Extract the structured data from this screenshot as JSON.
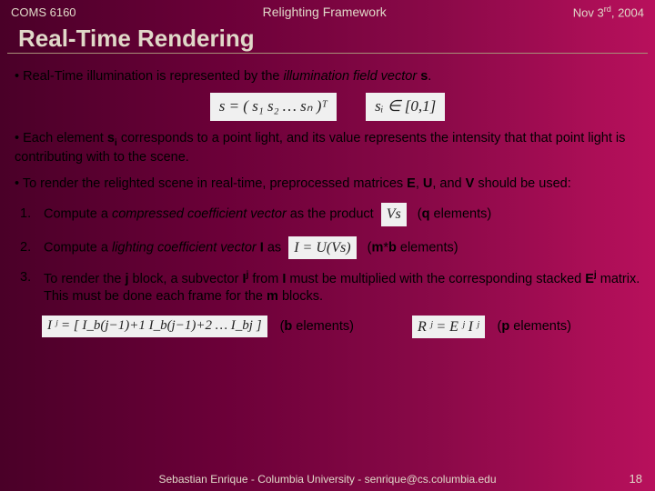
{
  "header": {
    "left": "COMS 6160",
    "center": "Relighting Framework",
    "right_pre": "Nov 3",
    "right_sup": "rd",
    "right_post": ", 2004"
  },
  "title": "Real-Time Rendering",
  "bullet1_a": "• Real-Time illumination is represented by the ",
  "bullet1_b": "illumination field vector ",
  "bullet1_c": "s",
  "bullet1_d": ".",
  "formula1_left": "s = ( s₁  s₂  …  sₙ )ᵀ",
  "formula1_right": "sᵢ ∈ [0,1]",
  "bullet2_a": "• Each element ",
  "bullet2_b": "s",
  "bullet2_c": " corresponds to a point light, and its value represents the intensity that that point light is contributing with to the scene.",
  "bullet2_sub": "i",
  "bullet3_a": "• To render the relighted scene in real-time, preprocessed matrices ",
  "bullet3_E": "E",
  "bullet3_U": "U",
  "bullet3_V": "V",
  "bullet3_b": ", and ",
  "bullet3_c": " should be used:",
  "step1": {
    "num": "1.",
    "a": "Compute a ",
    "b": "compressed coefficient vector",
    "c": " as the product",
    "formula": "Vs",
    "paren_a": "(",
    "paren_b": "q",
    "paren_c": " elements)"
  },
  "step2": {
    "num": "2.",
    "a": "Compute a ",
    "b": "lighting coefficient vector ",
    "c": "I",
    "d": " as",
    "formula": "I = U(Vs)",
    "paren_a": "(",
    "paren_b": "m",
    "paren_c": "*",
    "paren_d": "b",
    "paren_e": " elements)"
  },
  "step3": {
    "num": "3.",
    "a": "To render the ",
    "b": "j",
    "c": " block, a subvector ",
    "d": "I",
    "dsup": "j",
    "e": " from ",
    "f": "I",
    "g": " must be multiplied with the corresponding stacked ",
    "h": "E",
    "hsup": "j",
    "i": " matrix. This must be done each frame for the ",
    "j": "m",
    "k": " blocks."
  },
  "bottom": {
    "formula_left": "I ʲ = [ I_b(j−1)+1  I_b(j−1)+2  …  I_bj ]",
    "paren1_a": "(",
    "paren1_b": "b",
    "paren1_c": " elements)",
    "formula_right": "R ʲ = E ʲ I ʲ",
    "paren2_a": "(",
    "paren2_b": "p",
    "paren2_c": " elements)"
  },
  "footer": {
    "text": "Sebastian Enrique - Columbia University - senrique@cs.columbia.edu",
    "page": "18"
  }
}
